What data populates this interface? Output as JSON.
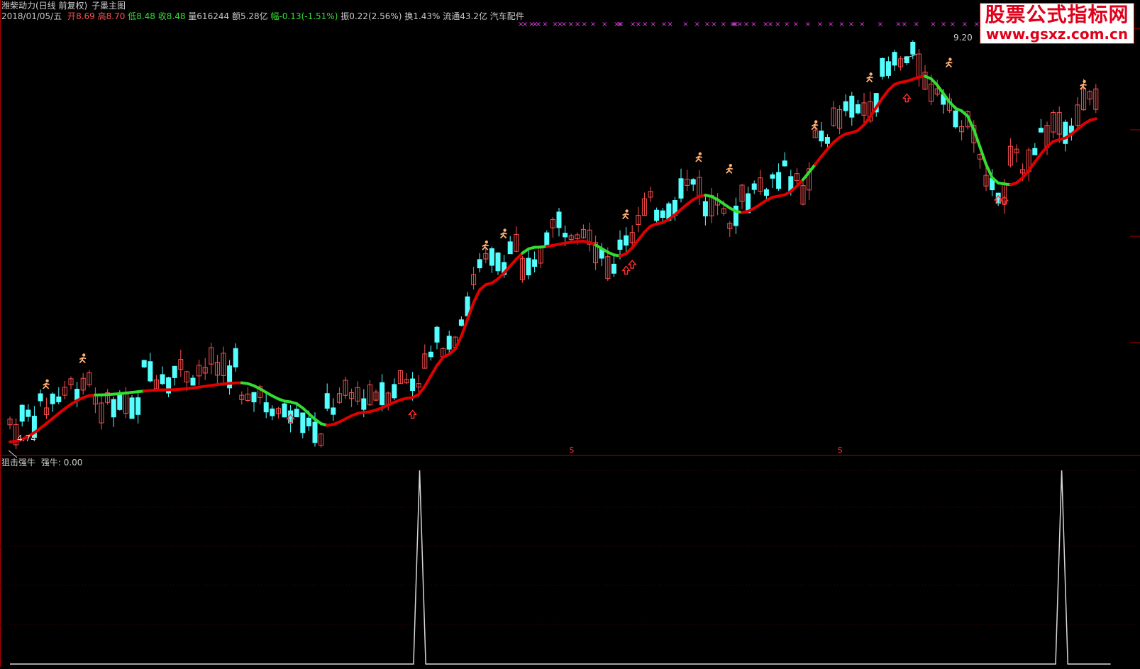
{
  "header": {
    "title": "潍柴动力(日线 前复权)",
    "indicator": "子墨主图",
    "date": "2018/01/05/五",
    "open_label": "开",
    "open": "8.69",
    "high_label": "高",
    "high": "8.70",
    "low_label": "低",
    "low": "8.48",
    "close_label": "收",
    "close": "8.48",
    "volume": "量616244",
    "amount": "额5.28亿",
    "change_label": "幅",
    "change": "-0.13(-1.51%)",
    "amplitude": "振0.22(2.56%)",
    "turnover": "换1.43%",
    "float": "流通43.2亿",
    "sector": "汽车配件"
  },
  "sub_header": {
    "name": "狙击强牛",
    "value_label": "强牛: 0.00"
  },
  "watermark": {
    "line1": "股票公式指标网",
    "line2": "www.gsxz.com.cn"
  },
  "colors": {
    "background": "#000000",
    "candle_up": "#ff5050",
    "candle_down": "#54ffff",
    "ma_up": "#e00000",
    "ma_down": "#33dd33",
    "marker_x": "#e040e0",
    "runner": "#ffb070",
    "arrow": "#ff3030",
    "signal_line": "#d8d8d8",
    "grid": "#5a0000"
  },
  "chart_data": [
    {
      "type": "candlestick",
      "title": "潍柴动力(日线 前复权)",
      "price_labels": {
        "max": "9.20",
        "min": "4.74"
      },
      "ylim": [
        4.6,
        9.5
      ],
      "ma_key_points": [
        [
          0,
          4.74
        ],
        [
          14,
          5.28
        ],
        [
          26,
          5.34
        ],
        [
          38,
          5.42
        ],
        [
          46,
          5.2
        ],
        [
          52,
          4.93
        ],
        [
          58,
          5.08
        ],
        [
          66,
          5.25
        ],
        [
          72,
          5.75
        ],
        [
          78,
          6.55
        ],
        [
          86,
          6.98
        ],
        [
          94,
          7.05
        ],
        [
          100,
          6.88
        ],
        [
          106,
          7.25
        ],
        [
          114,
          7.58
        ],
        [
          120,
          7.38
        ],
        [
          126,
          7.57
        ],
        [
          138,
          8.3
        ],
        [
          146,
          8.88
        ],
        [
          150,
          8.95
        ],
        [
          156,
          8.55
        ],
        [
          162,
          7.72
        ],
        [
          164,
          7.7
        ],
        [
          172,
          8.22
        ],
        [
          178,
          8.46
        ]
      ],
      "ma_trend_down_ranges": [
        [
          14,
          22
        ],
        [
          38,
          52
        ],
        [
          84,
          88
        ],
        [
          96,
          100
        ],
        [
          114,
          120
        ],
        [
          130,
          132
        ],
        [
          150,
          164
        ]
      ],
      "buy_arrows_at": [
        46,
        66,
        101,
        102,
        147,
        162,
        163
      ],
      "runner_icons_at": [
        6,
        12,
        78,
        81,
        101,
        113,
        118,
        132,
        141,
        154,
        176
      ],
      "sell_marks_at": [
        92,
        136
      ],
      "sell_mark_label": "S"
    },
    {
      "type": "line",
      "title": "狙击强牛",
      "series": [
        {
          "name": "强牛",
          "values": [
            [
              0,
              0
            ],
            [
              66,
              0
            ],
            [
              67,
              1
            ],
            [
              68,
              0
            ],
            [
              171,
              0
            ],
            [
              172,
              1
            ],
            [
              173,
              0
            ],
            [
              180,
              0
            ]
          ]
        }
      ],
      "ylim": [
        0,
        1
      ]
    }
  ]
}
